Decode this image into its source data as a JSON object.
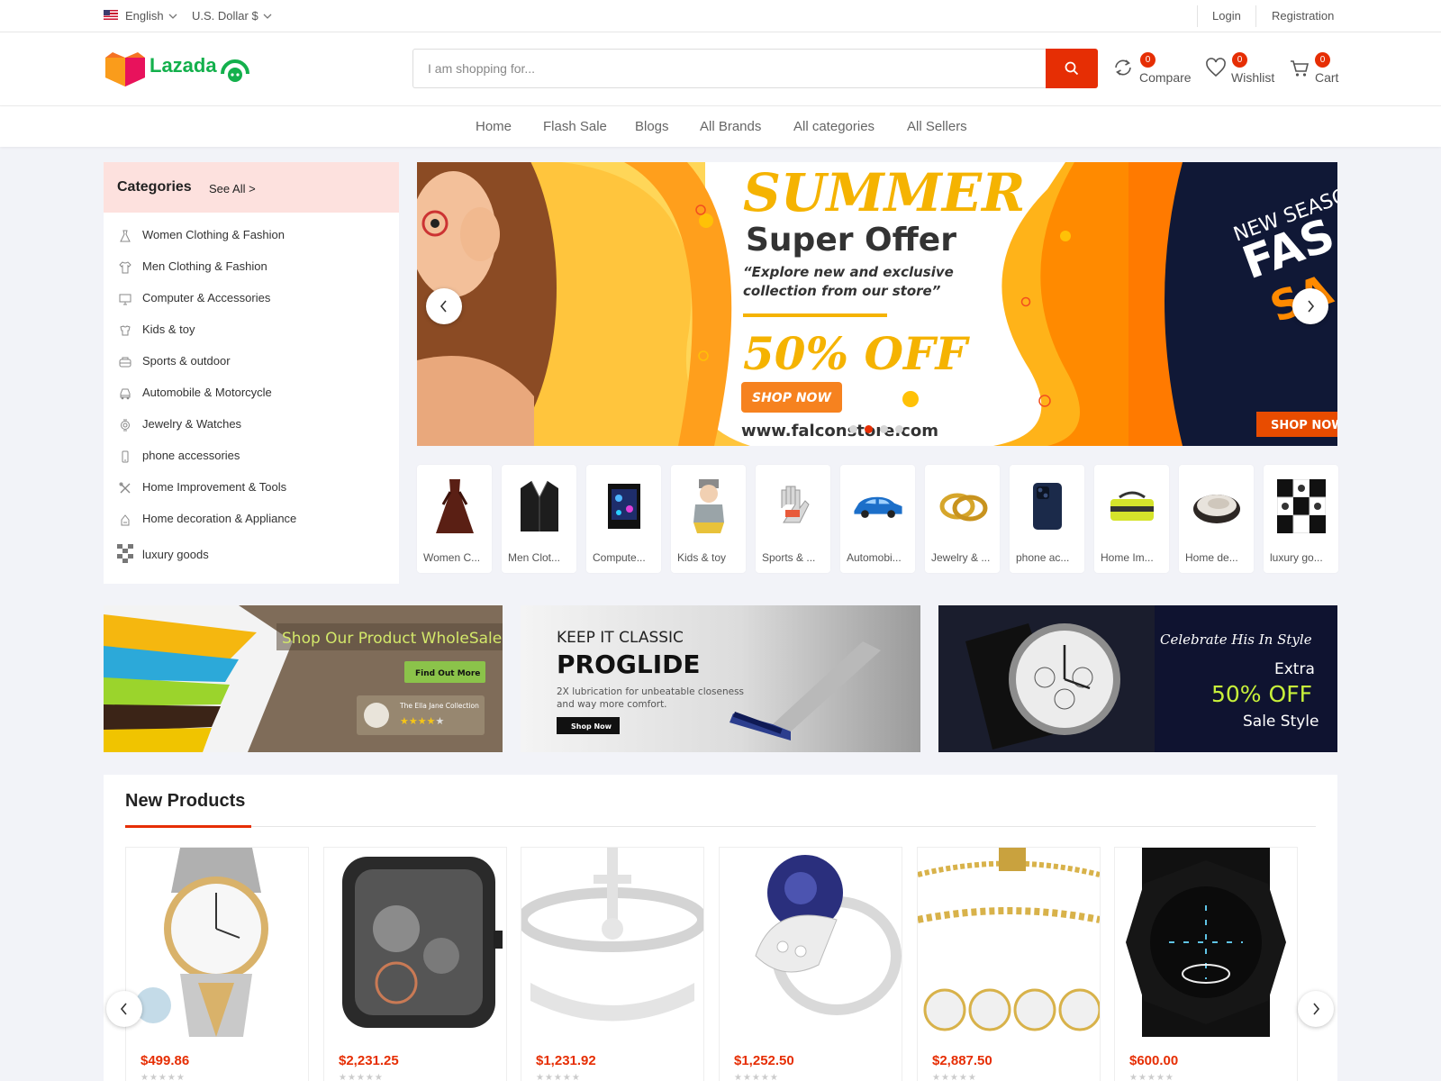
{
  "topbar": {
    "language": "English",
    "currency": "U.S. Dollar $",
    "login": "Login",
    "registration": "Registration"
  },
  "header": {
    "logo_text": "Lazada",
    "search_placeholder": "I am shopping for...",
    "compare_label": "Compare",
    "compare_count": "0",
    "wishlist_label": "Wishlist",
    "wishlist_count": "0",
    "cart_label": "Cart",
    "cart_count": "0"
  },
  "nav": [
    "Home",
    "Flash Sale",
    "Blogs",
    "All Brands",
    "All categories",
    "All Sellers"
  ],
  "categories": {
    "title": "Categories",
    "see_all": "See All >",
    "items": [
      "Women Clothing & Fashion",
      "Men Clothing & Fashion",
      "Computer & Accessories",
      "Kids & toy",
      "Sports & outdoor",
      "Automobile & Motorcycle",
      "Jewelry & Watches",
      "phone accessories",
      "Home Improvement & Tools",
      "Home decoration & Appliance",
      "luxury goods"
    ]
  },
  "hero": {
    "headline": "SUMMER",
    "subheadline": "Super Offer",
    "quote_line1": "“Explore new and exclusive",
    "quote_line2": "collection from our store”",
    "discount": "50% OFF",
    "cta": "SHOP NOW",
    "url": "www.falconstore.com",
    "side_small": "NEW SEASO",
    "side_big1": "FAS",
    "side_big2": "SA",
    "side_cta": "SHOP NOW",
    "active_slide": 2,
    "slide_count": 4
  },
  "category_cards": [
    "Women C...",
    "Men Clot...",
    "Compute...",
    "Kids & toy",
    "Sports & ...",
    "Automobi...",
    "Jewelry & ...",
    "phone ac...",
    "Home Im...",
    "Home de...",
    "luxury go..."
  ],
  "promos": {
    "wholesale": {
      "title": "Shop Our Product WholeSale",
      "button": "Find Out More",
      "badge": "The Ella Jane Collection"
    },
    "proglide": {
      "small": "KEEP IT CLASSIC",
      "big": "PROGLIDE",
      "desc1": "2X lubrication for unbeatable closeness",
      "desc2": "and way more comfort.",
      "button": "Shop Now"
    },
    "watch": {
      "script": "Celebrate His In Style",
      "extra": "Extra",
      "off": "50% OFF",
      "style": "Sale Style"
    }
  },
  "new_products": {
    "title": "New Products",
    "stars": "★★★★★",
    "prices": [
      "$499.86",
      "$2,231.25",
      "$1,231.92",
      "$1,252.50",
      "$2,887.50",
      "$600.00"
    ]
  },
  "colors": {
    "accent": "#e62e04",
    "brand_green": "#13b04c",
    "category_header": "#fde1de"
  }
}
